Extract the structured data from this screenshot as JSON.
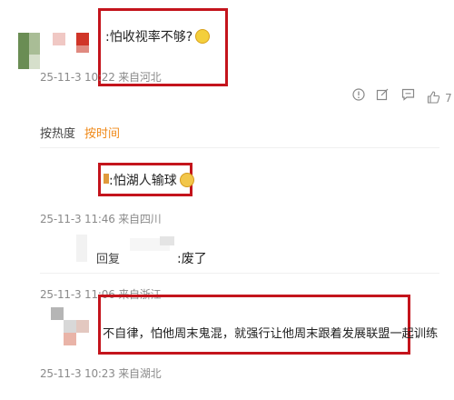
{
  "top_comment": {
    "text": ":怕收视率不够?",
    "emoji": "worried-face-emoji",
    "meta": "25-11-3 10:22 来自河北",
    "actions": {
      "like_count": "7"
    }
  },
  "sort_tabs": {
    "hot": "按热度",
    "time": "按时间"
  },
  "replies": [
    {
      "text": ":怕湖人输球",
      "emoji": "cat-face-emoji",
      "meta": "25-11-3 11:46 来自四川"
    },
    {
      "reply_prefix": "回复",
      "text": ":废了",
      "meta": "25-11-3 11:06 来自浙江"
    },
    {
      "text": "不自律，怕他周末鬼混，就强行让他周末跟着发展联盟一起训练",
      "meta": "25-11-3 10:23 来自湖北"
    }
  ],
  "colors": {
    "highlight_box": "#c4141c",
    "active_tab": "#f08a1a",
    "meta_text": "#8a8a8a"
  }
}
